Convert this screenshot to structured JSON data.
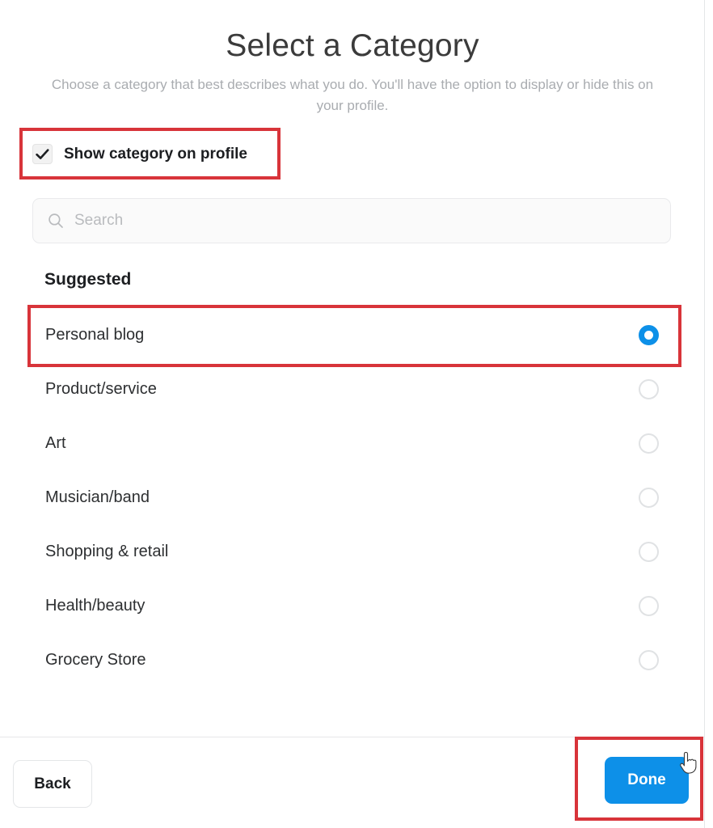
{
  "header": {
    "title": "Select a Category",
    "subtitle": "Choose a category that best describes what you do. You'll have the option to display or hide this on your profile."
  },
  "options": {
    "show_category_label": "Show category on profile",
    "show_category_checked": true,
    "checkbox_icon": "check-icon"
  },
  "search": {
    "placeholder": "Search",
    "value": "",
    "icon": "search-icon"
  },
  "section": {
    "heading": "Suggested"
  },
  "categories": [
    {
      "label": "Personal blog",
      "selected": true
    },
    {
      "label": "Product/service",
      "selected": false
    },
    {
      "label": "Art",
      "selected": false
    },
    {
      "label": "Musician/band",
      "selected": false
    },
    {
      "label": "Shopping & retail",
      "selected": false
    },
    {
      "label": "Health/beauty",
      "selected": false
    },
    {
      "label": "Grocery Store",
      "selected": false
    }
  ],
  "footer": {
    "back_label": "Back",
    "done_label": "Done"
  },
  "colors": {
    "accent_blue": "#0d90e8",
    "annotation_red": "#d8343a",
    "text_primary": "#1c1e21",
    "text_muted": "#a9acb0",
    "radio_empty": "#e0e2e4"
  },
  "cursor": {
    "icon": "pointer-hand-cursor"
  }
}
